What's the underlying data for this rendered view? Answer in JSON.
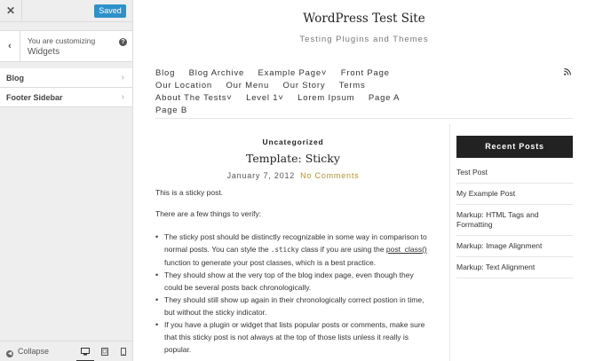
{
  "customizer": {
    "close_glyph": "✕",
    "saved_label": "Saved",
    "back_glyph": "‹",
    "section_caption": "You are customizing",
    "section_title": "Widgets",
    "help_glyph": "?",
    "items": [
      {
        "label": "Blog"
      },
      {
        "label": "Footer Sidebar"
      }
    ],
    "chevron_glyph": "›",
    "collapse_label": "Collapse",
    "devices": [
      "desktop-icon",
      "tablet-icon",
      "mobile-icon"
    ],
    "accent_color": "#2e91c9"
  },
  "site": {
    "title": "WordPress Test Site",
    "description": "Testing Plugins and Themes"
  },
  "menu": {
    "row1": [
      "Blog",
      "Blog Archive",
      "Example Page˅",
      "Front Page"
    ],
    "row2": [
      "Our Location",
      "Our Menu",
      "Our Story",
      "Terms"
    ],
    "row3": [
      "About The Tests˅",
      "Level 1˅",
      "Lorem Ipsum",
      "Page A"
    ],
    "row4": [
      "Page B"
    ]
  },
  "post": {
    "category": "Uncategorized",
    "title": "Template: Sticky",
    "date": "January 7, 2012",
    "comments": "No Comments",
    "intro": "This is a sticky post.",
    "verify": "There are a few things to verify:",
    "bullets": {
      "b1_pre": "The sticky post should be distinctly recognizable in some way in comparison to normal posts. You can style the ",
      "b1_code": ".sticky",
      "b1_mid": " class if you are using the ",
      "b1_link": "post_class()",
      "b1_post": " function to generate your post classes, which is a best practice.",
      "b2": "They should show at the very top of the blog index page, even though they could be several posts back chronologically.",
      "b3": "They should still show up again in their chronologically correct postion in time, but without the sticky indicator.",
      "b4": "If you have a plugin or widget that lists popular posts or comments, make sure that this sticky post is not always at the top of those lists unless it really is popular."
    }
  },
  "sidebar": {
    "widget_title": "Recent Posts",
    "posts": [
      "Test Post",
      "My Example Post",
      "Markup: HTML Tags and Formatting",
      "Markup: Image Alignment",
      "Markup: Text Alignment"
    ]
  }
}
